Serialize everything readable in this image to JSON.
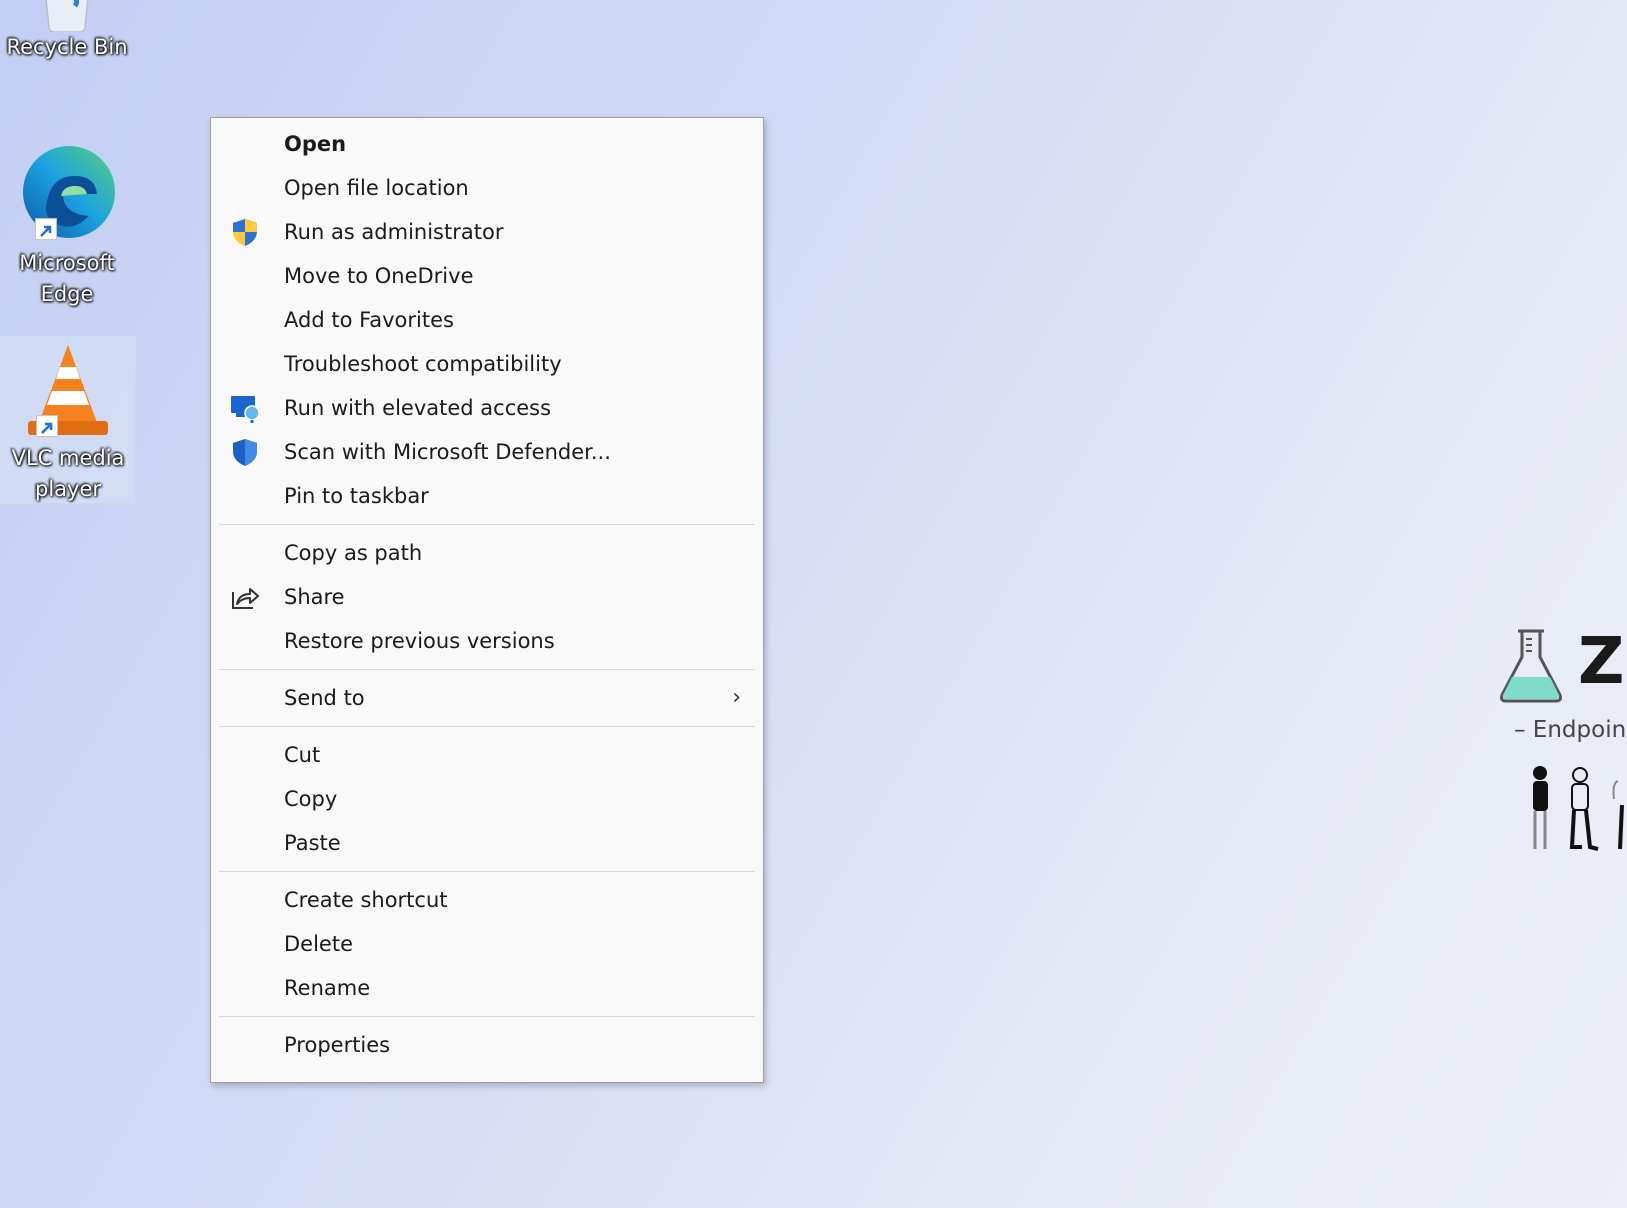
{
  "desktop": {
    "icons": [
      {
        "label": "Recycle Bin",
        "icon": "recycle-bin-icon"
      },
      {
        "label": "Microsoft Edge",
        "icon": "edge-icon"
      },
      {
        "label": "VLC media player",
        "icon": "vlc-icon",
        "selected": true
      }
    ]
  },
  "context_menu": {
    "groups": [
      [
        {
          "label": "Open",
          "bold": true
        },
        {
          "label": "Open file location"
        },
        {
          "label": "Run as administrator",
          "icon": "uac-shield-icon"
        },
        {
          "label": "Move to OneDrive"
        },
        {
          "label": "Add to Favorites"
        },
        {
          "label": "Troubleshoot compatibility"
        },
        {
          "label": "Run with elevated access",
          "icon": "elevated-access-icon"
        },
        {
          "label": "Scan with Microsoft Defender...",
          "icon": "defender-shield-icon"
        },
        {
          "label": "Pin to taskbar"
        }
      ],
      [
        {
          "label": "Copy as path"
        },
        {
          "label": "Share",
          "icon": "share-icon"
        },
        {
          "label": "Restore previous versions"
        }
      ],
      [
        {
          "label": "Send to",
          "submenu": true,
          "arrow": "›"
        }
      ],
      [
        {
          "label": "Cut"
        },
        {
          "label": "Copy"
        },
        {
          "label": "Paste"
        }
      ],
      [
        {
          "label": "Create shortcut"
        },
        {
          "label": "Delete"
        },
        {
          "label": "Rename"
        }
      ],
      [
        {
          "label": "Properties"
        }
      ]
    ]
  },
  "wallpaper": {
    "brand_letter": "Z",
    "tagline": "– Endpoin",
    "accent_color": "#7fdcc8"
  }
}
